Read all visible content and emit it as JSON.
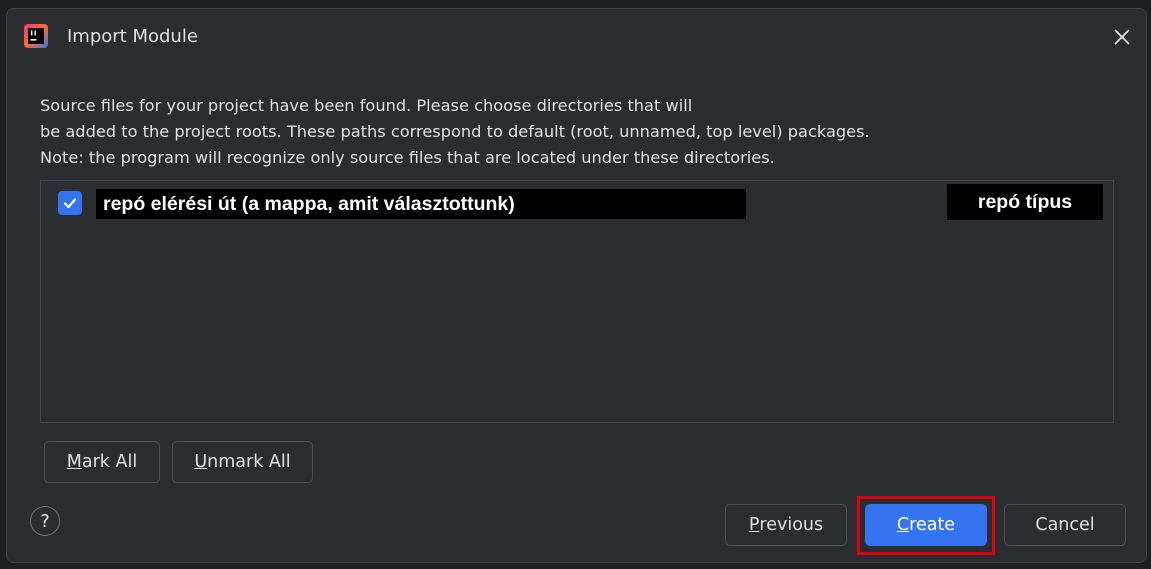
{
  "window": {
    "title": "Import Module",
    "app_icon": "intellij-idea-icon",
    "close_icon": "close-icon"
  },
  "description": {
    "line1": "Source files for your project have been found. Please choose directories that will",
    "line2": "be added to the project roots. These paths correspond to default (root, unnamed, top level) packages.",
    "line3": "Note: the program will recognize only source files that are located under these directories."
  },
  "roots_list": {
    "items": [
      {
        "checked": true,
        "path": "repó elérési út (a mappa, amit választottunk)",
        "type": "repó típus"
      }
    ]
  },
  "list_buttons": {
    "mark_all_mnemonic": "M",
    "mark_all_rest": "ark All",
    "unmark_all_mnemonic": "U",
    "unmark_all_rest": "nmark All"
  },
  "footer": {
    "help_label": "?",
    "previous_mnemonic": "P",
    "previous_rest": "revious",
    "create_mnemonic": "C",
    "create_rest": "reate",
    "cancel_label": "Cancel"
  },
  "colors": {
    "accent": "#3574f0",
    "highlight_box": "#e0000f",
    "dialog_background": "#2b2d30"
  }
}
